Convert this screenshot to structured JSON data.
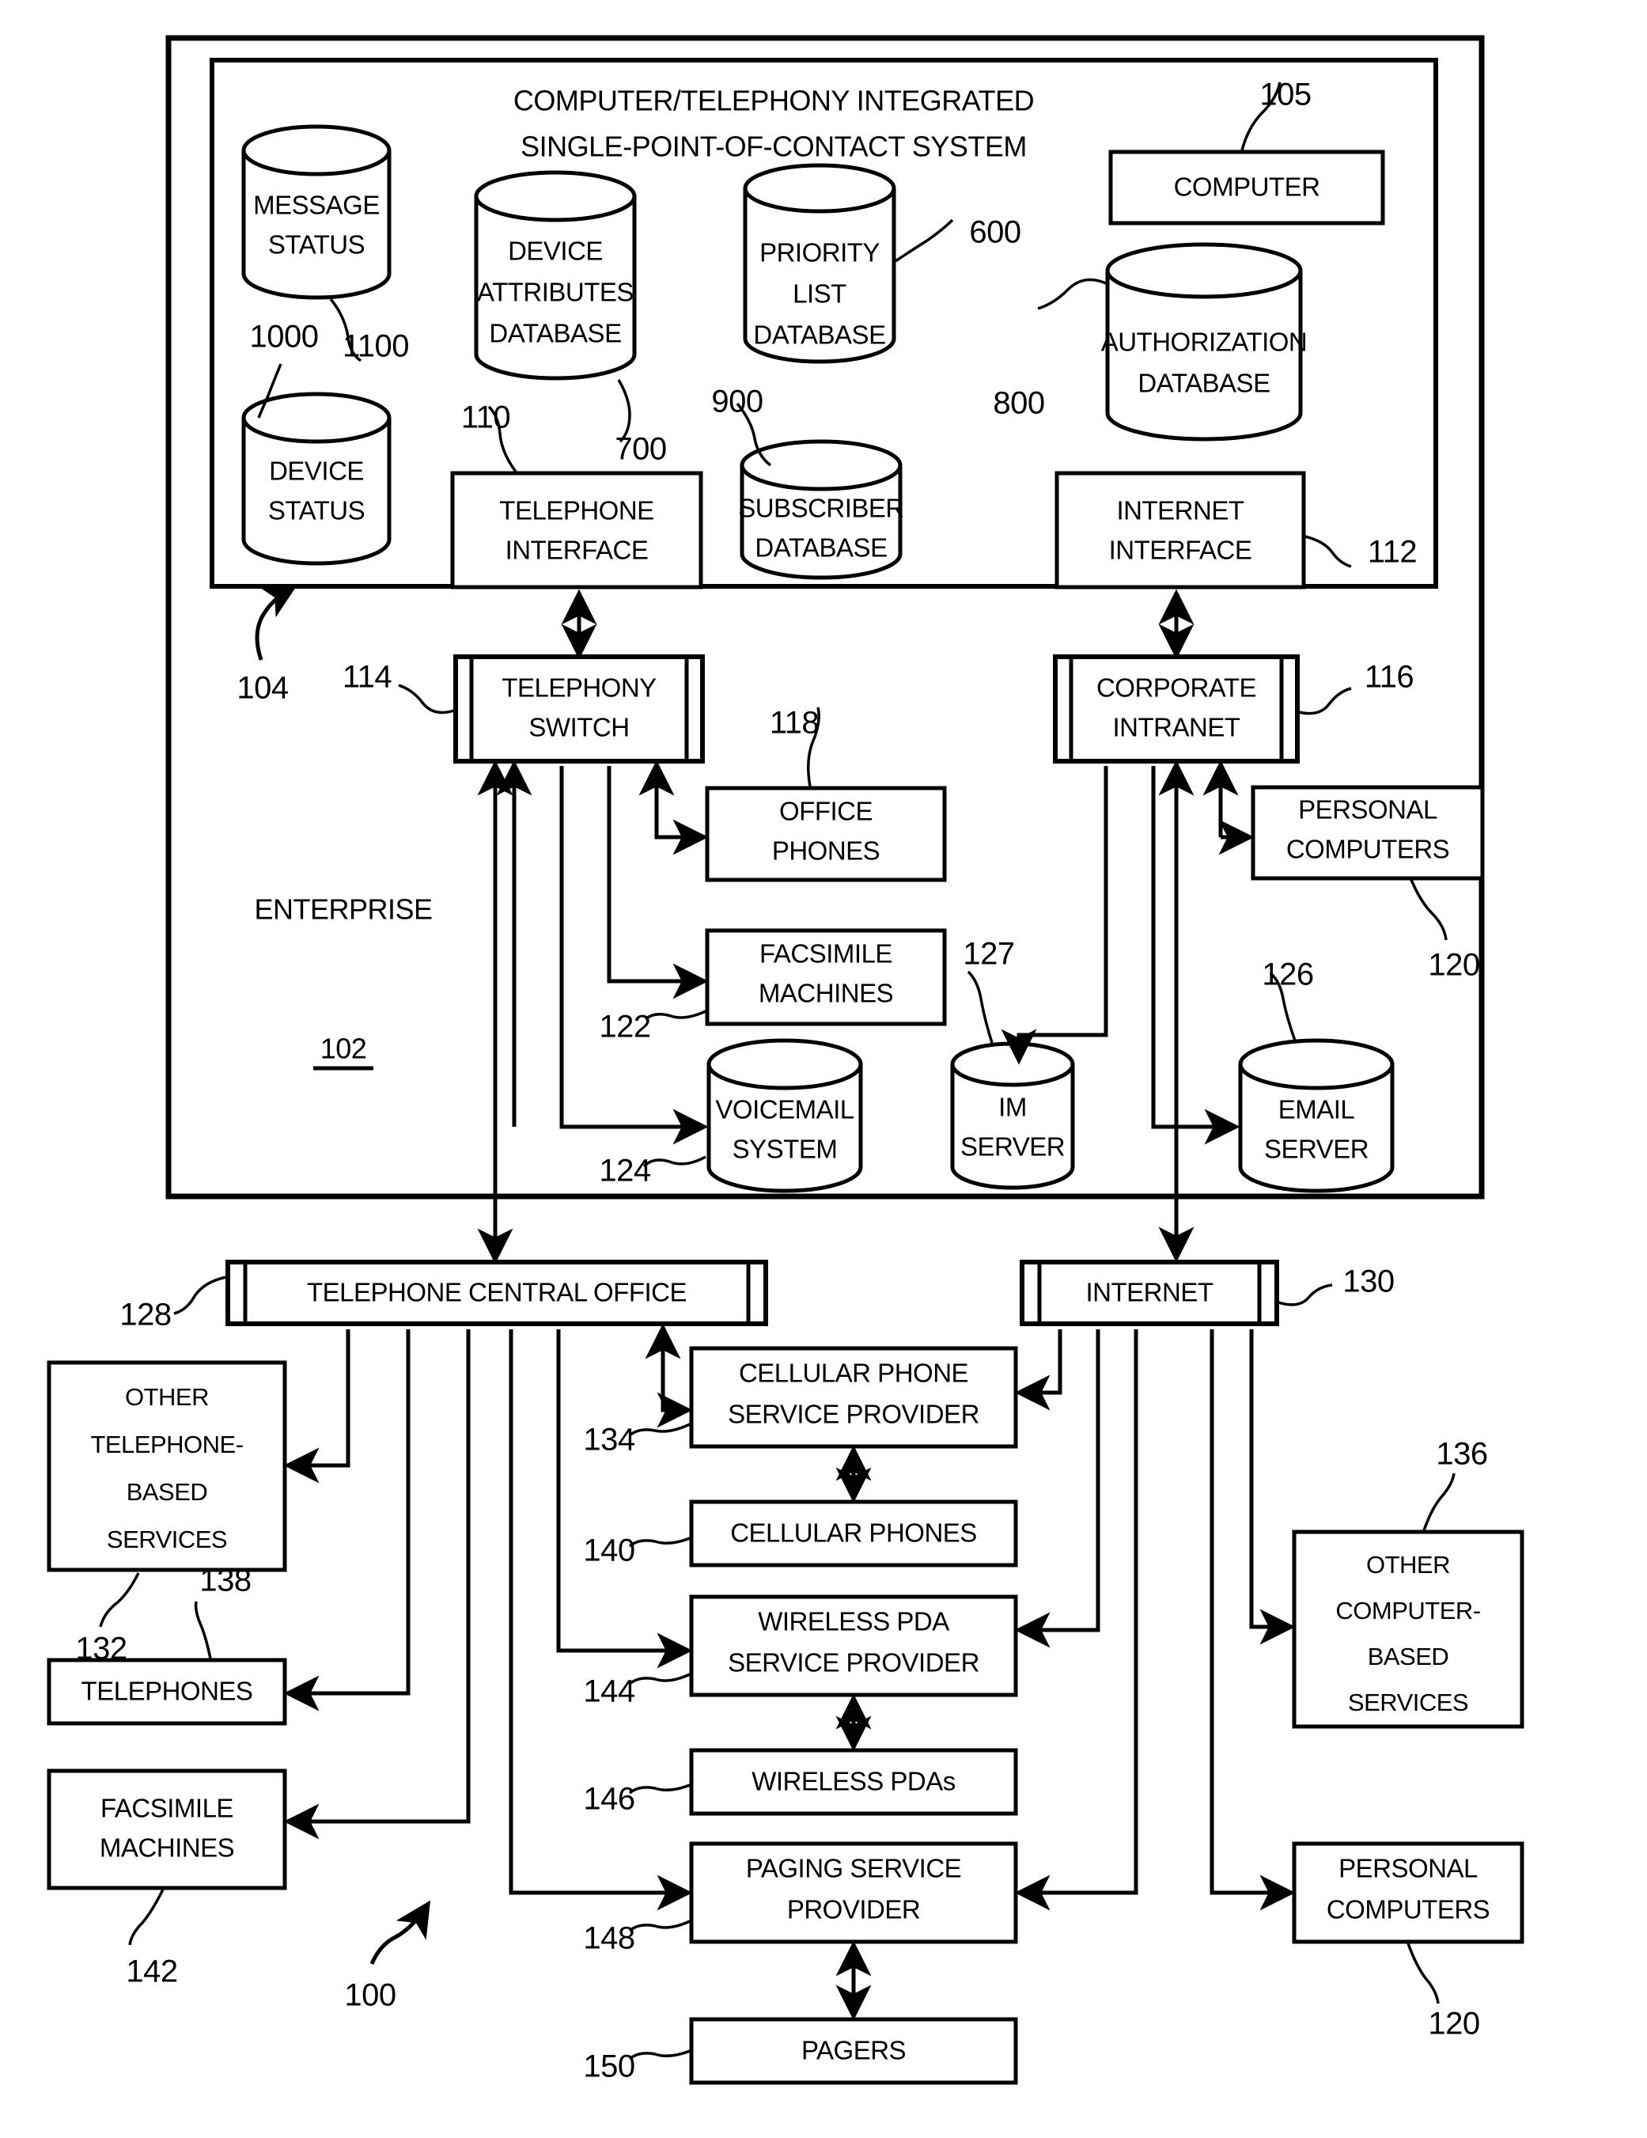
{
  "figure": {
    "figure_ref": "100",
    "system_title_line1": "COMPUTER/TELEPHONY INTEGRATED",
    "system_title_line2": "SINGLE-POINT-OF-CONTACT SYSTEM",
    "enterprise_label": "ENTERPRISE",
    "enterprise_ref": "102",
    "system_ref": "104"
  },
  "system_nodes": {
    "message_status": {
      "line1": "MESSAGE",
      "line2": "STATUS",
      "ref": "1100",
      "type": "cylinder"
    },
    "device_status": {
      "line1": "DEVICE",
      "line2": "STATUS",
      "ref": "1000",
      "type": "cylinder"
    },
    "device_attributes_db": {
      "line1": "DEVICE",
      "line2": "ATTRIBUTES",
      "line3": "DATABASE",
      "ref": "700",
      "type": "cylinder"
    },
    "priority_list_db": {
      "line1": "PRIORITY",
      "line2": "LIST",
      "line3": "DATABASE",
      "ref": "600",
      "type": "cylinder"
    },
    "subscriber_db": {
      "line1": "SUBSCRIBER",
      "line2": "DATABASE",
      "ref": "900",
      "type": "cylinder"
    },
    "authorization_db": {
      "line1": "AUTHORIZATION",
      "line2": "DATABASE",
      "ref": "800",
      "type": "cylinder"
    },
    "computer": {
      "line1": "COMPUTER",
      "ref": "105",
      "type": "box"
    },
    "telephone_interface": {
      "line1": "TELEPHONE",
      "line2": "INTERFACE",
      "ref": "110",
      "type": "box"
    },
    "internet_interface": {
      "line1": "INTERNET",
      "line2": "INTERFACE",
      "ref": "112",
      "type": "box"
    }
  },
  "enterprise_nodes": {
    "telephony_switch": {
      "line1": "TELEPHONY",
      "line2": "SWITCH",
      "ref": "114",
      "type": "bus"
    },
    "corporate_intranet": {
      "line1": "CORPORATE",
      "line2": "INTRANET",
      "ref": "116",
      "type": "bus"
    },
    "office_phones": {
      "line1": "OFFICE",
      "line2": "PHONES",
      "ref": "118",
      "type": "box"
    },
    "facsimile_machines": {
      "line1": "FACSIMILE",
      "line2": "MACHINES",
      "ref": "122",
      "type": "box"
    },
    "voicemail_system": {
      "line1": "VOICEMAIL",
      "line2": "SYSTEM",
      "ref": "124",
      "type": "cylinder"
    },
    "im_server": {
      "line1": "IM",
      "line2": "SERVER",
      "ref": "127",
      "type": "cylinder"
    },
    "email_server": {
      "line1": "EMAIL",
      "line2": "SERVER",
      "ref": "126",
      "type": "cylinder"
    },
    "personal_computers": {
      "line1": "PERSONAL",
      "line2": "COMPUTERS",
      "ref": "120",
      "type": "box"
    }
  },
  "network_nodes": {
    "telephone_central_office": {
      "line1": "TELEPHONE CENTRAL OFFICE",
      "ref": "128",
      "type": "bus"
    },
    "internet": {
      "line1": "INTERNET",
      "ref": "130",
      "type": "bus"
    }
  },
  "external_nodes": {
    "other_telephone_based_services": {
      "line1": "OTHER",
      "line2": "TELEPHONE-",
      "line3": "BASED",
      "line4": "SERVICES",
      "ref": "132",
      "type": "box"
    },
    "telephones": {
      "line1": "TELEPHONES",
      "ref": "138",
      "type": "box"
    },
    "facsimile_machines_ext": {
      "line1": "FACSIMILE",
      "line2": "MACHINES",
      "ref": "142",
      "type": "box"
    },
    "cellular_phone_service_provider": {
      "line1": "CELLULAR PHONE",
      "line2": "SERVICE PROVIDER",
      "ref": "134",
      "type": "box"
    },
    "cellular_phones": {
      "line1": "CELLULAR PHONES",
      "ref": "140",
      "type": "box"
    },
    "wireless_pda_service_provider": {
      "line1": "WIRELESS PDA",
      "line2": "SERVICE PROVIDER",
      "ref": "144",
      "type": "box"
    },
    "wireless_pdas": {
      "line1": "WIRELESS PDAs",
      "ref": "146",
      "type": "box"
    },
    "paging_service_provider": {
      "line1": "PAGING SERVICE",
      "line2": "PROVIDER",
      "ref": "148",
      "type": "box"
    },
    "pagers": {
      "line1": "PAGERS",
      "ref": "150",
      "type": "box"
    },
    "other_computer_based_services": {
      "line1": "OTHER",
      "line2": "COMPUTER-",
      "line3": "BASED",
      "line4": "SERVICES",
      "ref": "136",
      "type": "box"
    },
    "personal_computers_ext": {
      "line1": "PERSONAL",
      "line2": "COMPUTERS",
      "ref": "120",
      "type": "box"
    }
  }
}
